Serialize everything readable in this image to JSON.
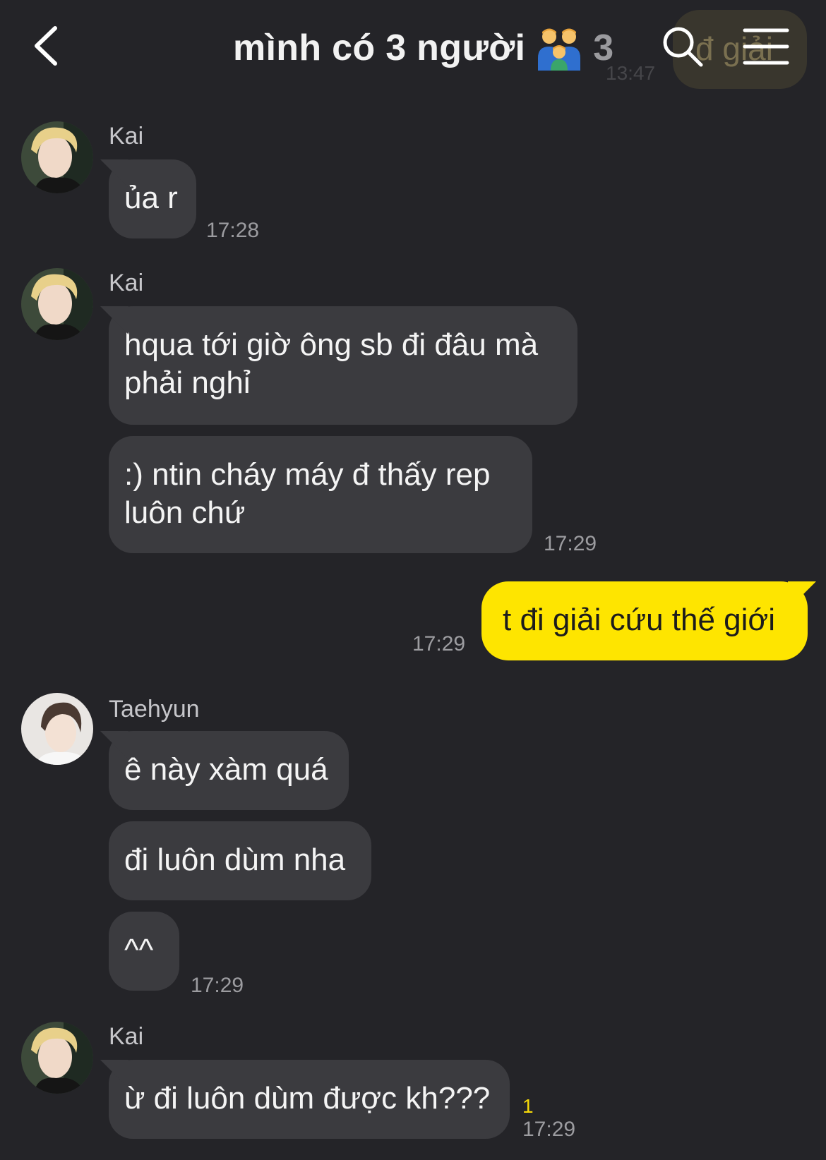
{
  "header": {
    "title": "mình có 3 người",
    "member_count": "3",
    "ghost_preview_text": "đ giải",
    "ghost_preview_time": "13:47"
  },
  "colors": {
    "background": "#242428",
    "incoming_bubble": "#3b3b3f",
    "outgoing_bubble": "#fee500",
    "unread_badge": "#f5d90a"
  },
  "messages": [
    {
      "sender": "Kai",
      "bubbles": [
        "ủa r"
      ],
      "time": "17:28"
    },
    {
      "sender": "Kai",
      "bubbles": [
        "hqua tới giờ ông sb đi đâu mà phải nghỉ",
        ":) ntin cháy máy đ thấy rep luôn chứ"
      ],
      "time": "17:29"
    },
    {
      "sender": "me",
      "bubbles": [
        "t đi giải cứu thế giới"
      ],
      "time": "17:29"
    },
    {
      "sender": "Taehyun",
      "bubbles": [
        "ê này xàm quá",
        "đi luôn dùm nha",
        "^^"
      ],
      "time": "17:29"
    },
    {
      "sender": "Kai",
      "bubbles": [
        "ừ đi luôn dùm được kh???"
      ],
      "time": "17:29",
      "unread": "1"
    }
  ]
}
